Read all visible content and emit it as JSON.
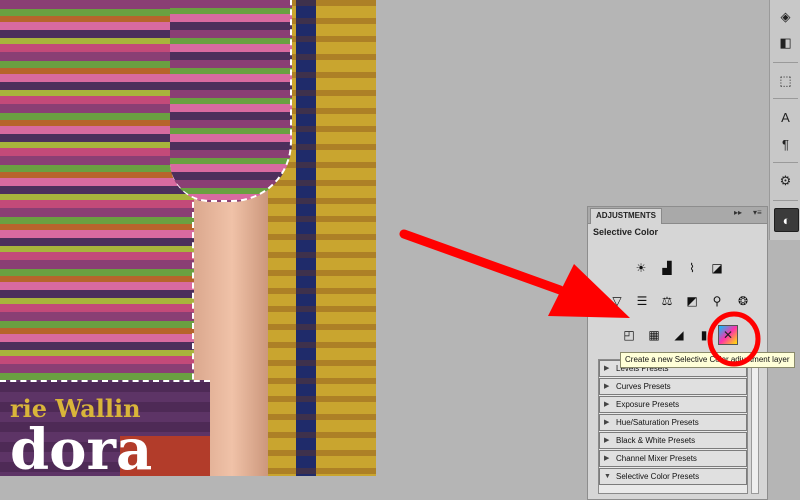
{
  "canvas": {
    "magazine_text_line1": "rie Wallin",
    "magazine_text_line2": "dora"
  },
  "toolbar": {
    "tools": [
      {
        "name": "3d-icon",
        "glyph": "◈"
      },
      {
        "name": "adjustment-layers-icon",
        "glyph": "◧"
      },
      {
        "name": "transform-icon",
        "glyph": "⬚"
      },
      {
        "name": "character-icon",
        "glyph": "A"
      },
      {
        "name": "paragraph-icon",
        "glyph": "¶"
      },
      {
        "name": "clone-source-icon",
        "glyph": "⚙"
      },
      {
        "name": "adjustments-panel-icon",
        "glyph": "◐"
      }
    ]
  },
  "panel": {
    "tab_label": "ADJUSTMENTS",
    "collapse_glyph": "▸▸",
    "menu_glyph": "▾≡",
    "title": "Selective Color",
    "adjustment_icons": [
      {
        "name": "brightness-contrast-icon",
        "glyph": "☀"
      },
      {
        "name": "levels-icon",
        "glyph": "▟"
      },
      {
        "name": "curves-icon",
        "glyph": "⌇"
      },
      {
        "name": "exposure-icon",
        "glyph": "◪"
      },
      {
        "name": "vibrance-icon",
        "glyph": "▽"
      },
      {
        "name": "hue-saturation-icon",
        "glyph": "☰"
      },
      {
        "name": "color-balance-icon",
        "glyph": "⚖"
      },
      {
        "name": "black-white-icon",
        "glyph": "◩"
      },
      {
        "name": "photo-filter-icon",
        "glyph": "⚲"
      },
      {
        "name": "channel-mixer-icon",
        "glyph": "❂"
      },
      {
        "name": "invert-icon",
        "glyph": "◰"
      },
      {
        "name": "posterize-icon",
        "glyph": "▦"
      },
      {
        "name": "threshold-icon",
        "glyph": "◢"
      },
      {
        "name": "gradient-map-icon",
        "glyph": "▮"
      },
      {
        "name": "selective-color-icon",
        "glyph": "✕"
      }
    ],
    "presets": [
      {
        "label": "Levels Presets",
        "arrow": "▶"
      },
      {
        "label": "Curves Presets",
        "arrow": "▶"
      },
      {
        "label": "Exposure Presets",
        "arrow": "▶"
      },
      {
        "label": "Hue/Saturation Presets",
        "arrow": "▶"
      },
      {
        "label": "Black & White Presets",
        "arrow": "▶"
      },
      {
        "label": "Channel Mixer Presets",
        "arrow": "▶"
      },
      {
        "label": "Selective Color Presets",
        "arrow": "▼"
      }
    ]
  },
  "tooltip": {
    "text": "Create a new Selective Color adjustment layer"
  },
  "colors": {
    "annotation": "#ff0000",
    "app_background": "#b5b5b5",
    "panel_background": "#d6d6d6",
    "tooltip_background": "#ffffd8"
  }
}
